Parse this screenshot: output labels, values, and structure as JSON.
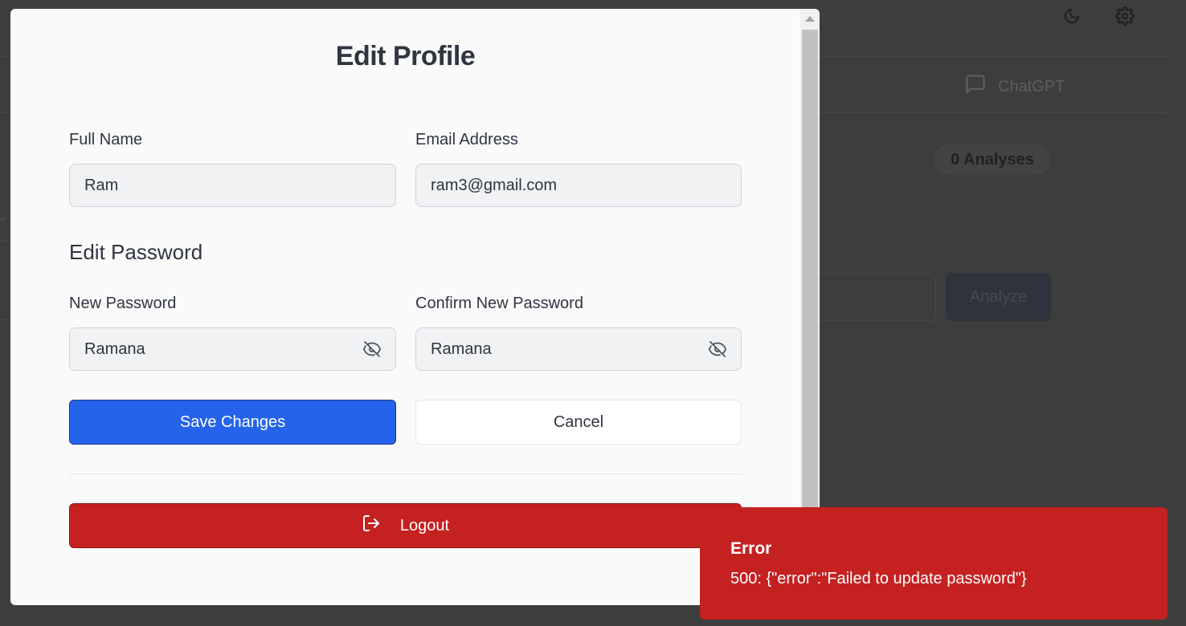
{
  "background": {
    "tab_chatgpt": "ChatGPT",
    "analyses_badge": "0 Analyses",
    "analyze_button": "Analyze"
  },
  "modal": {
    "title": "Edit Profile",
    "full_name": {
      "label": "Full Name",
      "value": "Ram"
    },
    "email": {
      "label": "Email Address",
      "value": "ram3@gmail.com"
    },
    "password_section_title": "Edit Password",
    "new_password": {
      "label": "New Password",
      "value": "Ramana"
    },
    "confirm_password": {
      "label": "Confirm New Password",
      "value": "Ramana"
    },
    "save_label": "Save Changes",
    "cancel_label": "Cancel",
    "logout_label": "Logout"
  },
  "toast": {
    "title": "Error",
    "message": "500: {\"error\":\"Failed to update password\"}"
  },
  "colors": {
    "primary": "#2563eb",
    "danger": "#c52121",
    "overlay": "#3d3d3d",
    "modal_bg": "#fafafa"
  },
  "icons": [
    "moon-icon",
    "gear-icon",
    "chat-bubble-icon",
    "eye-off-icon",
    "logout-icon"
  ]
}
